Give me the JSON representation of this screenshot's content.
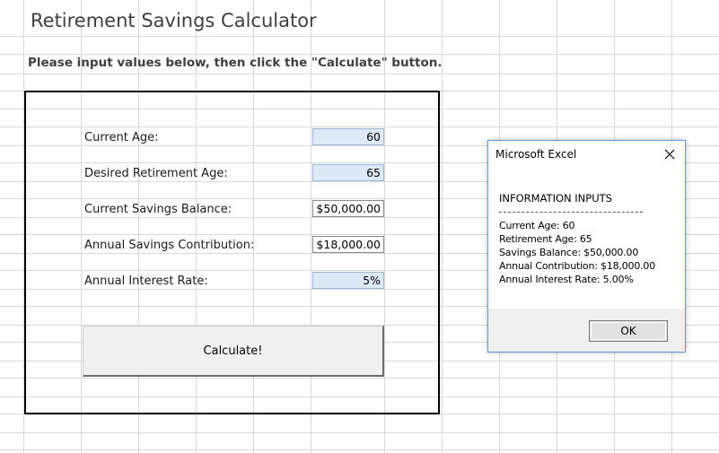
{
  "title": "Retirement Savings Calculator",
  "subtitle": "Please input values below, then click the \"Calculate\" button.",
  "form": {
    "fields": [
      {
        "label": "Current Age:",
        "value": "60"
      },
      {
        "label": "Desired Retirement Age:",
        "value": "65"
      },
      {
        "label": "Current Savings Balance:",
        "value": "$50,000.00"
      },
      {
        "label": "Annual Savings Contribution:",
        "value": "$18,000.00"
      },
      {
        "label": "Annual Interest Rate:",
        "value": "5%"
      }
    ],
    "calculate_label": "Calculate!"
  },
  "dialog": {
    "title": "Microsoft Excel",
    "close_icon": "close-icon",
    "heading": "INFORMATION INPUTS",
    "lines": [
      "Current Age: 60",
      "Retirement Age: 65",
      "Savings Balance: $50,000.00",
      "Annual Contribution: $18,000.00",
      "Annual Interest Rate: 5.00%"
    ],
    "ok_label": "OK"
  },
  "colors": {
    "input_fill": "#dde9f6",
    "dialog_border": "#5b9bd5",
    "gridline": "#d9d9d9"
  }
}
